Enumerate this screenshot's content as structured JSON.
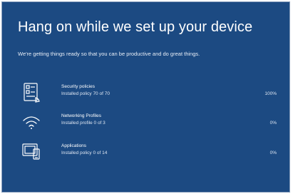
{
  "title": "Hang on while we set up your device",
  "subtitle": "We're getting things ready so that you can be productive and do great things.",
  "steps": [
    {
      "icon": "security-policies-icon",
      "name": "Security policies",
      "detail": "Installed policy 70 of 70",
      "percent": "100%"
    },
    {
      "icon": "wifi-icon",
      "name": "Networking Profiles",
      "detail": "Installed profile 0 of 3",
      "percent": "0%"
    },
    {
      "icon": "applications-icon",
      "name": "Applications",
      "detail": "Installed policy 0 of 14",
      "percent": "0%"
    }
  ],
  "colors": {
    "background": "#1c4a82",
    "text": "#ffffff"
  }
}
